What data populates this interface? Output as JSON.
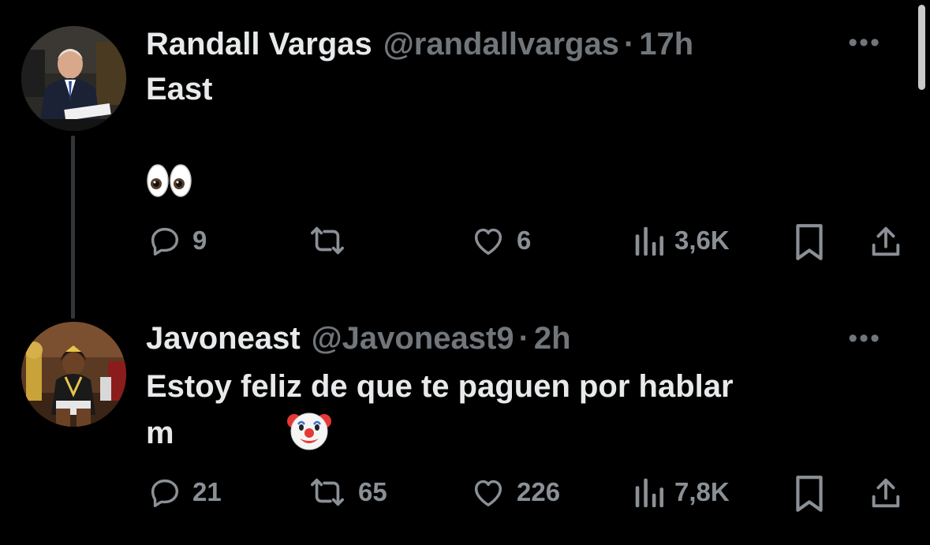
{
  "tweets": [
    {
      "name": "Randall Vargas",
      "handle": "@randallvargas",
      "separator": "·",
      "time": "17h",
      "text_line1": "East",
      "emoji": "eyes",
      "actions": {
        "replies": "9",
        "retweets": "",
        "likes": "6",
        "views": "3,6K"
      }
    },
    {
      "name": "Javoneast",
      "handle": "@Javoneast9",
      "separator": "·",
      "time": "2h",
      "text_line1": "Estoy feliz de que te paguen por hablar",
      "text_line2": "m",
      "emoji": "clown-face",
      "actions": {
        "replies": "21",
        "retweets": "65",
        "likes": "226",
        "views": "7,8K"
      }
    }
  ],
  "more_label": "•••",
  "colors": {
    "background": "#000000",
    "text": "#e7e9ea",
    "secondary": "#71767b",
    "icon": "#8b9096"
  }
}
